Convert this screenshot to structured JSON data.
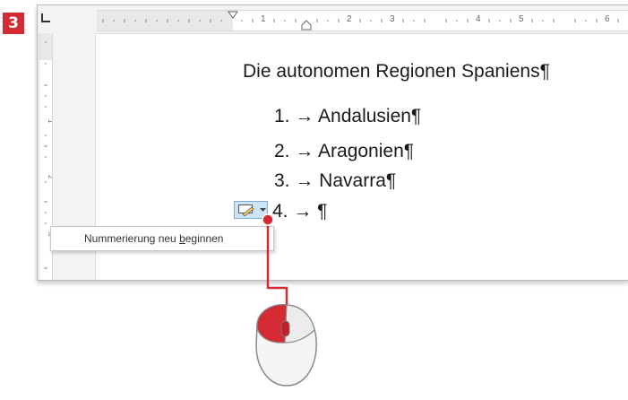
{
  "step_badge": "3",
  "ruler": {
    "marks": [
      "1",
      "2",
      "3",
      "4",
      "5",
      "6"
    ]
  },
  "document": {
    "title": "Die autonomen Regionen Spaniens¶",
    "list_items": [
      "1. → Andalusien¶",
      "2. → Aragonien¶",
      "3. → Navarra¶",
      "4. → ¶"
    ]
  },
  "autocorrect_options": {
    "icon": "autocorrect-options-icon"
  },
  "context_menu": {
    "items": [
      {
        "label_pre": "Nummerierung neu ",
        "label_accel": "b",
        "label_post": "eginnen"
      }
    ]
  },
  "colors": {
    "accent": "#d42a34",
    "selection": "#cde4f7"
  }
}
